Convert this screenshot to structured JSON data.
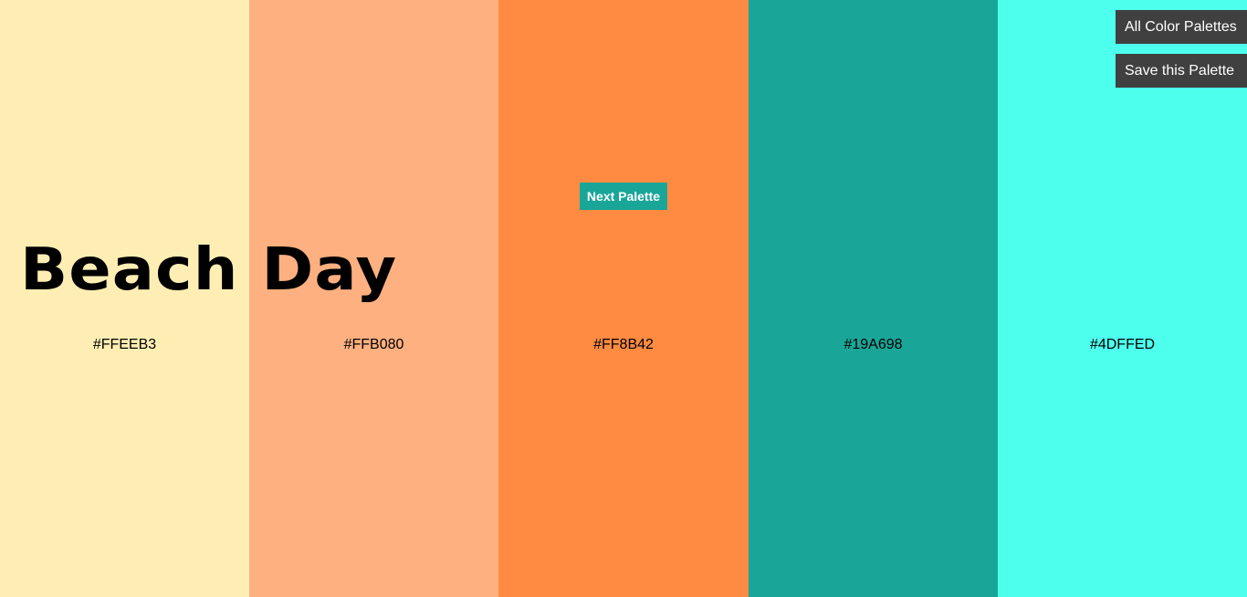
{
  "palette": {
    "name": "Beach Day",
    "colors": [
      {
        "hex": "#FFEEB3",
        "label": "#FFEEB3"
      },
      {
        "hex": "#FFB080",
        "label": "#FFB080"
      },
      {
        "hex": "#FF8B42",
        "label": "#FF8B42"
      },
      {
        "hex": "#19A698",
        "label": "#19A698"
      },
      {
        "hex": "#4DFFED",
        "label": "#4DFFED"
      }
    ]
  },
  "buttons": {
    "next_palette": "Next Palette",
    "all_palettes": "All Color Palettes",
    "save_palette": "Save this Palette"
  },
  "theme": {
    "next_button_bg": "#19A698",
    "toolbar_button_bg": "#404040"
  }
}
